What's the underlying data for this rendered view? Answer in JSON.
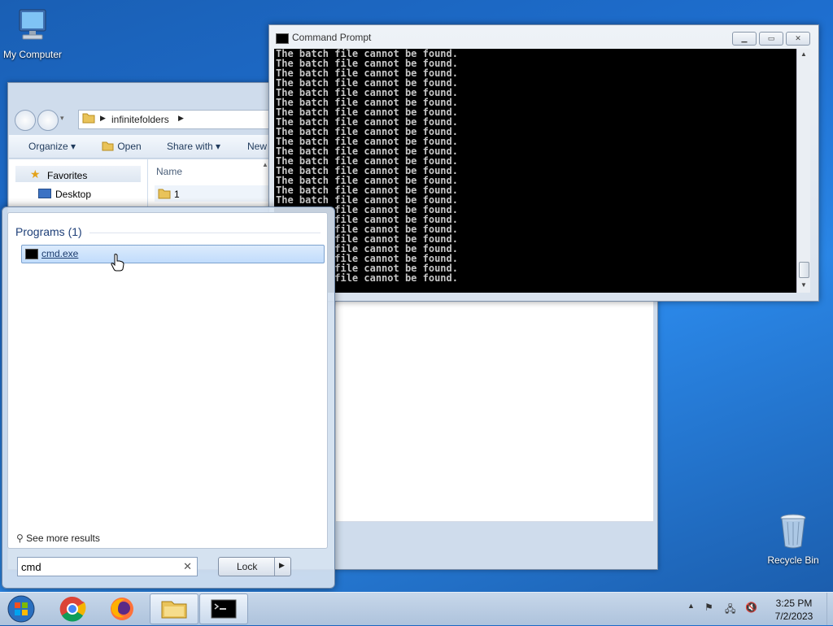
{
  "desktop": {
    "icons": [
      {
        "label": "My Computer"
      },
      {
        "label": "Recycle Bin"
      }
    ]
  },
  "explorer": {
    "breadcrumb": [
      "infinitefolders"
    ],
    "toolbar": {
      "organize": "Organize",
      "open": "Open",
      "share_with": "Share with",
      "new": "New"
    },
    "nav": {
      "favorites": "Favorites",
      "desktop": "Desktop"
    },
    "column_header": "Name",
    "files": [
      "1"
    ]
  },
  "cmd": {
    "title": "Command Prompt",
    "line": "The batch file cannot be found.",
    "line_count": 24,
    "partial_line": "file cannot be found.",
    "partial_from_index": 16
  },
  "start_menu": {
    "section_heading": "Programs (1)",
    "results": [
      {
        "label": "cmd.exe"
      }
    ],
    "see_more": "See more results",
    "search_value": "cmd",
    "lock_button": "Lock"
  },
  "taskbar": {
    "time": "3:25 PM",
    "date": "7/2/2023"
  }
}
